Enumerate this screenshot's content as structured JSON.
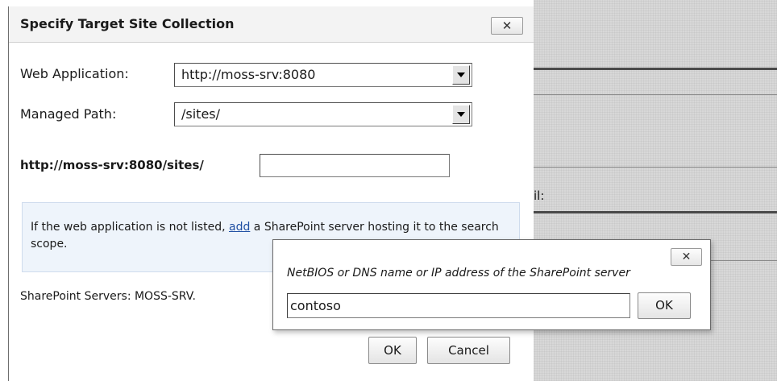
{
  "dialog": {
    "title": "Specify Target Site Collection",
    "close_label": "✕",
    "web_application": {
      "label": "Web Application:",
      "value": "http://moss-srv:8080"
    },
    "managed_path": {
      "label": "Managed Path:",
      "value": "/sites/"
    },
    "url_prefix": "http://moss-srv:8080/sites/",
    "site_name_value": "",
    "info": {
      "text_before": "If the web application is not listed, ",
      "link_text": "add",
      "text_after": " a SharePoint server hosting it to the search scope."
    },
    "servers_text": "SharePoint Servers: MOSS-SRV.",
    "ok_label": "OK",
    "cancel_label": "Cancel"
  },
  "popup": {
    "prompt": "NetBIOS or DNS name or IP address of the SharePoint server",
    "close_label": "✕",
    "input_value": "contoso",
    "ok_label": "OK"
  },
  "background": {
    "partial_label": "il:"
  }
}
